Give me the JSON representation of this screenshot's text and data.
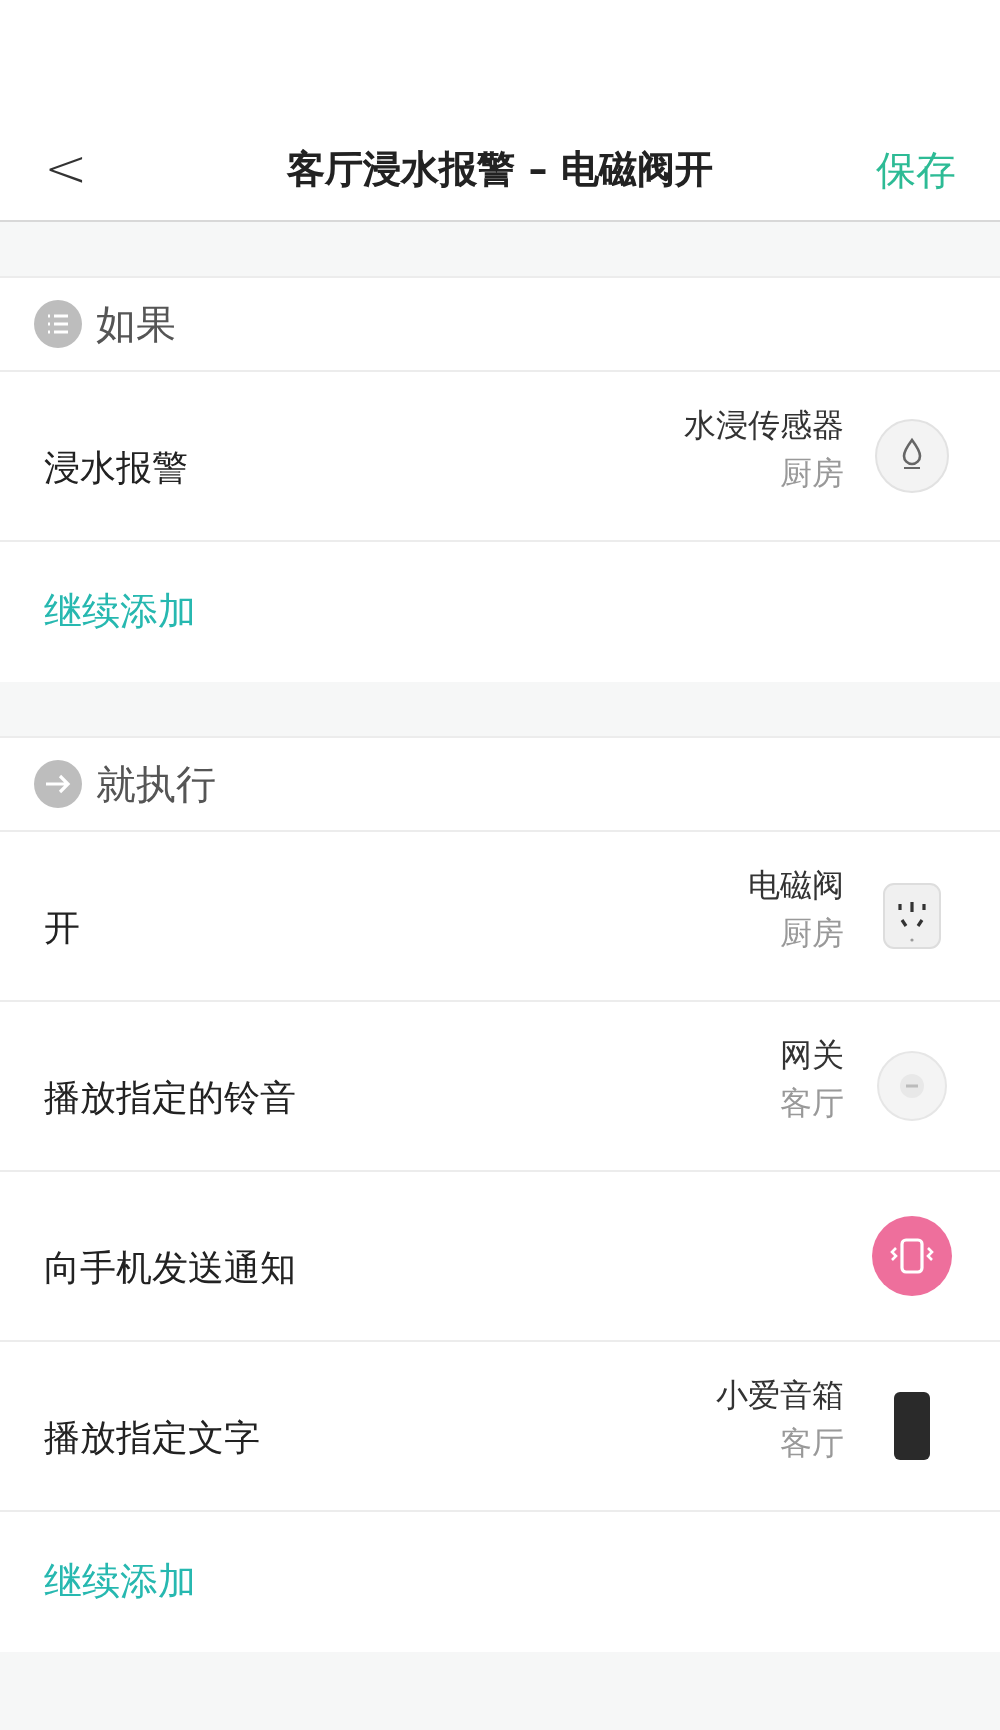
{
  "header": {
    "back": "<",
    "title": "客厅浸水报警 – 电磁阀开",
    "save": "保存"
  },
  "sections": [
    {
      "kind": "condition",
      "title": "如果",
      "items": [
        {
          "label": "浸水报警",
          "device": "水浸传感器",
          "room": "厨房",
          "kind": "sensor"
        }
      ],
      "add": "继续添加"
    },
    {
      "kind": "action",
      "title": "就执行",
      "items": [
        {
          "label": "开",
          "device": "电磁阀",
          "room": "厨房",
          "kind": "plug"
        },
        {
          "label": "播放指定的铃音",
          "device": "网关",
          "room": "客厅",
          "kind": "gateway"
        },
        {
          "label": "向手机发送通知",
          "kind": "phone"
        },
        {
          "label": "播放指定文字",
          "device": "小爱音箱",
          "room": "客厅",
          "kind": "speaker"
        }
      ],
      "add": "继续添加"
    }
  ]
}
